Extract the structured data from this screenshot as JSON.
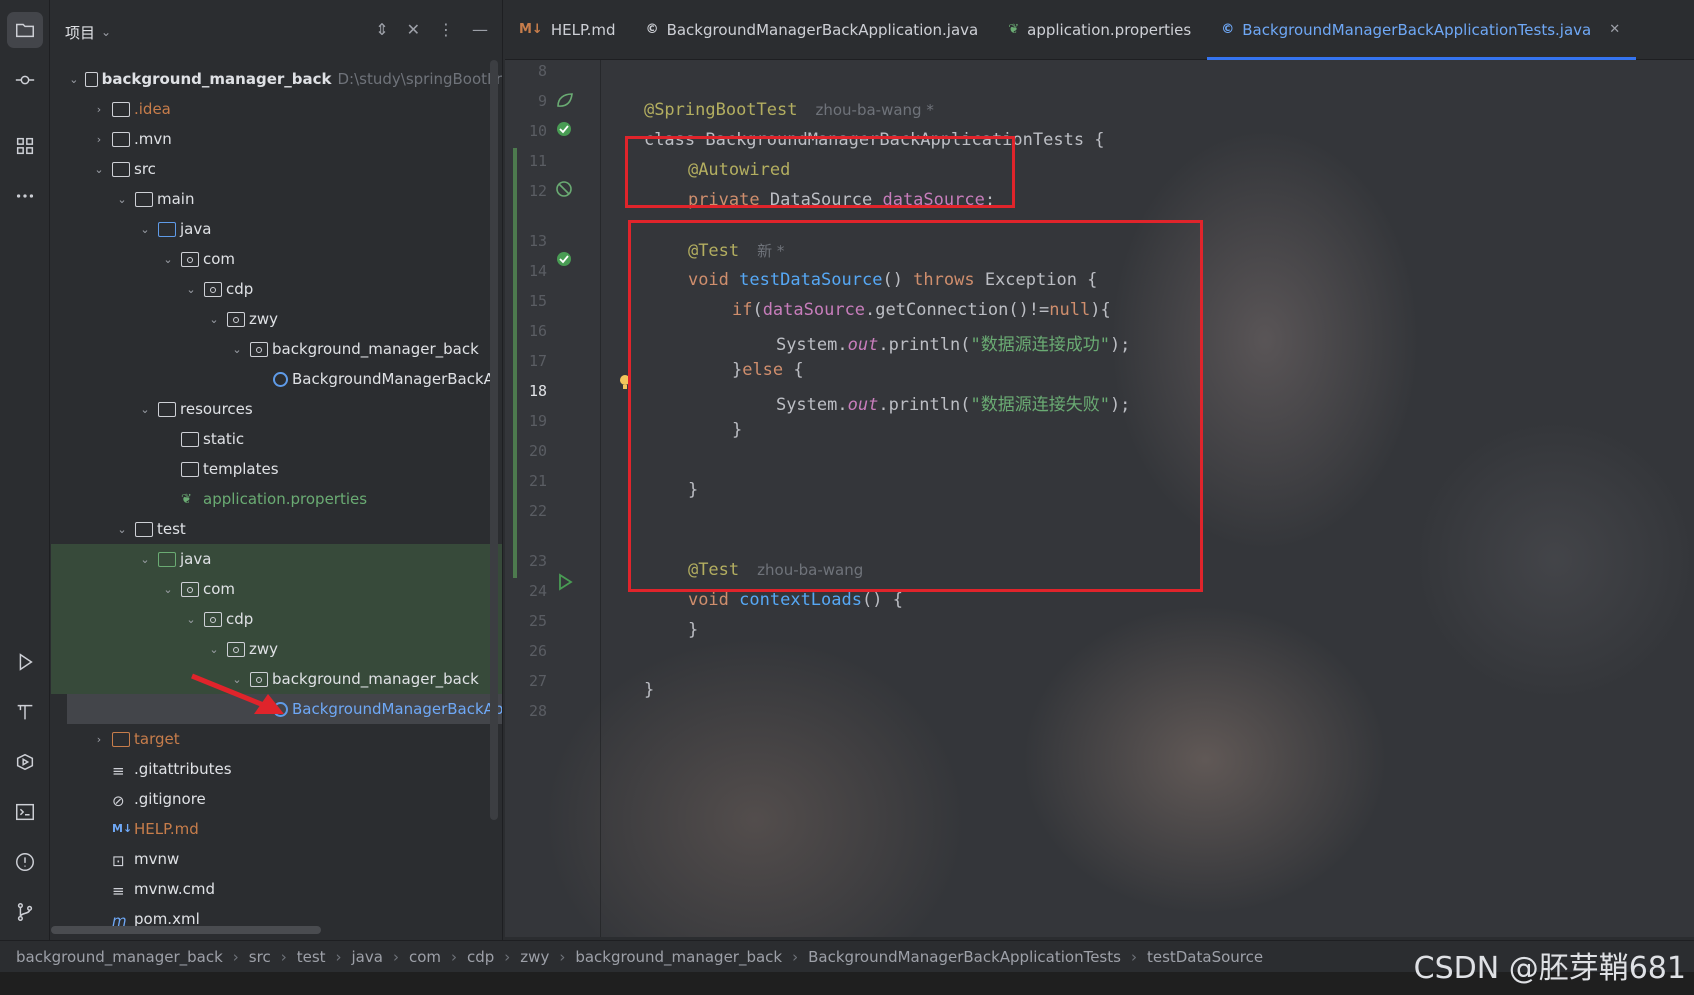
{
  "project_panel": {
    "title": "项目",
    "tree": [
      {
        "label": "background_manager_back",
        "suffix": "D:\\study\\springBootPr",
        "depth": 0,
        "arrow": "v",
        "icon": "folder",
        "bold": true
      },
      {
        "label": ".idea",
        "depth": 1,
        "arrow": ">",
        "icon": "folder",
        "color": "orange"
      },
      {
        "label": ".mvn",
        "depth": 1,
        "arrow": ">",
        "icon": "folder"
      },
      {
        "label": "src",
        "depth": 1,
        "arrow": "v",
        "icon": "folder"
      },
      {
        "label": "main",
        "depth": 2,
        "arrow": "v",
        "icon": "folder"
      },
      {
        "label": "java",
        "depth": 3,
        "arrow": "v",
        "icon": "folder-blue"
      },
      {
        "label": "com",
        "depth": 4,
        "arrow": "v",
        "icon": "package"
      },
      {
        "label": "cdp",
        "depth": 5,
        "arrow": "v",
        "icon": "package"
      },
      {
        "label": "zwy",
        "depth": 6,
        "arrow": "v",
        "icon": "package"
      },
      {
        "label": "background_manager_back",
        "depth": 7,
        "arrow": "v",
        "icon": "package"
      },
      {
        "label": "BackgroundManagerBackA",
        "depth": 8,
        "arrow": "",
        "icon": "class"
      },
      {
        "label": "resources",
        "depth": 3,
        "arrow": "v",
        "icon": "folder"
      },
      {
        "label": "static",
        "depth": 4,
        "arrow": "",
        "icon": "folder"
      },
      {
        "label": "templates",
        "depth": 4,
        "arrow": "",
        "icon": "folder"
      },
      {
        "label": "application.properties",
        "depth": 4,
        "arrow": "",
        "icon": "spring",
        "color": "green"
      },
      {
        "label": "test",
        "depth": 2,
        "arrow": "v",
        "icon": "folder"
      },
      {
        "label": "java",
        "depth": 3,
        "arrow": "v",
        "icon": "folder-green",
        "highlight": true
      },
      {
        "label": "com",
        "depth": 4,
        "arrow": "v",
        "icon": "package",
        "highlight": true
      },
      {
        "label": "cdp",
        "depth": 5,
        "arrow": "v",
        "icon": "package",
        "highlight": true
      },
      {
        "label": "zwy",
        "depth": 6,
        "arrow": "v",
        "icon": "package",
        "highlight": true
      },
      {
        "label": "background_manager_back",
        "depth": 7,
        "arrow": "v",
        "icon": "package",
        "highlight": true
      },
      {
        "label": "BackgroundManagerBackApplicationTests",
        "depth": 8,
        "arrow": "",
        "icon": "class",
        "selected": true,
        "color": "blue"
      },
      {
        "label": "target",
        "depth": 1,
        "arrow": ">",
        "icon": "folder-orange",
        "color": "orange"
      },
      {
        "label": ".gitattributes",
        "depth": 1,
        "arrow": "",
        "icon": "lines"
      },
      {
        "label": ".gitignore",
        "depth": 1,
        "arrow": "",
        "icon": "ignore"
      },
      {
        "label": "HELP.md",
        "depth": 1,
        "arrow": "",
        "icon": "md",
        "color": "orange"
      },
      {
        "label": "mvnw",
        "depth": 1,
        "arrow": "",
        "icon": "terminal"
      },
      {
        "label": "mvnw.cmd",
        "depth": 1,
        "arrow": "",
        "icon": "lines"
      },
      {
        "label": "pom.xml",
        "depth": 1,
        "arrow": "",
        "icon": "maven"
      }
    ]
  },
  "tabs": [
    {
      "label": "HELP.md",
      "icon": "M↓",
      "color": "#c77d4b"
    },
    {
      "label": "BackgroundManagerBackApplication.java",
      "icon": "©",
      "color": "#ced0d6"
    },
    {
      "label": "application.properties",
      "icon": "❦",
      "color": "#6aab73"
    },
    {
      "label": "BackgroundManagerBackApplicationTests.java",
      "icon": "©",
      "color": "#6fa8f6",
      "active": true
    }
  ],
  "editor": {
    "line_numbers": [
      "8",
      "9",
      "10",
      "11",
      "12",
      "",
      "13",
      "14",
      "15",
      "16",
      "17",
      "18",
      "19",
      "20",
      "21",
      "22",
      "",
      "23",
      "24",
      "25",
      "26",
      "27",
      "28"
    ],
    "current_line": "18",
    "lines": {
      "l9_ann": "@SpringBootTest",
      "l9_hint": "zhou-ba-wang *",
      "l10": "class BackgroundManagerBackApplicationTests {",
      "l11": "@Autowired",
      "l12_kw": "private",
      "l12_type": "DataSource",
      "l12_field": "dataSource",
      "l13_ann": "@Test",
      "l13_hint": "新 *",
      "l14_kw": "void",
      "l14_fn": "testDataSource",
      "l14_rest": "() ",
      "l14_throws": "throws",
      "l14_exc": " Exception {",
      "l15_if": "if",
      "l15_field": "dataSource",
      "l15_rest": ".getConnection()!=",
      "l15_null": "null",
      "l15_end": "){",
      "l16_sys": "System.",
      "l16_out": "out",
      "l16_print": ".println(",
      "l16_str": "\"数据源连接成功\"",
      "l16_end": ");",
      "l17_close": "}",
      "l17_else": "else",
      "l17_brace": " {",
      "l18_sys": "System.",
      "l18_out": "out",
      "l18_print": ".println(",
      "l18_str": "\"数据源连接失败\"",
      "l18_end": ");",
      "l19": "}",
      "l21": "}",
      "l23_ann": "@Test",
      "l23_hint": "zhou-ba-wang",
      "l24_kw": "void",
      "l24_fn": "contextLoads",
      "l24_rest": "() {",
      "l25": "}",
      "l26": "}"
    }
  },
  "breadcrumb": [
    "background_manager_back",
    "src",
    "test",
    "java",
    "com",
    "cdp",
    "zwy",
    "background_manager_back",
    "BackgroundManagerBackApplicationTests",
    "testDataSource"
  ],
  "watermark": "CSDN @胚芽鞘681"
}
